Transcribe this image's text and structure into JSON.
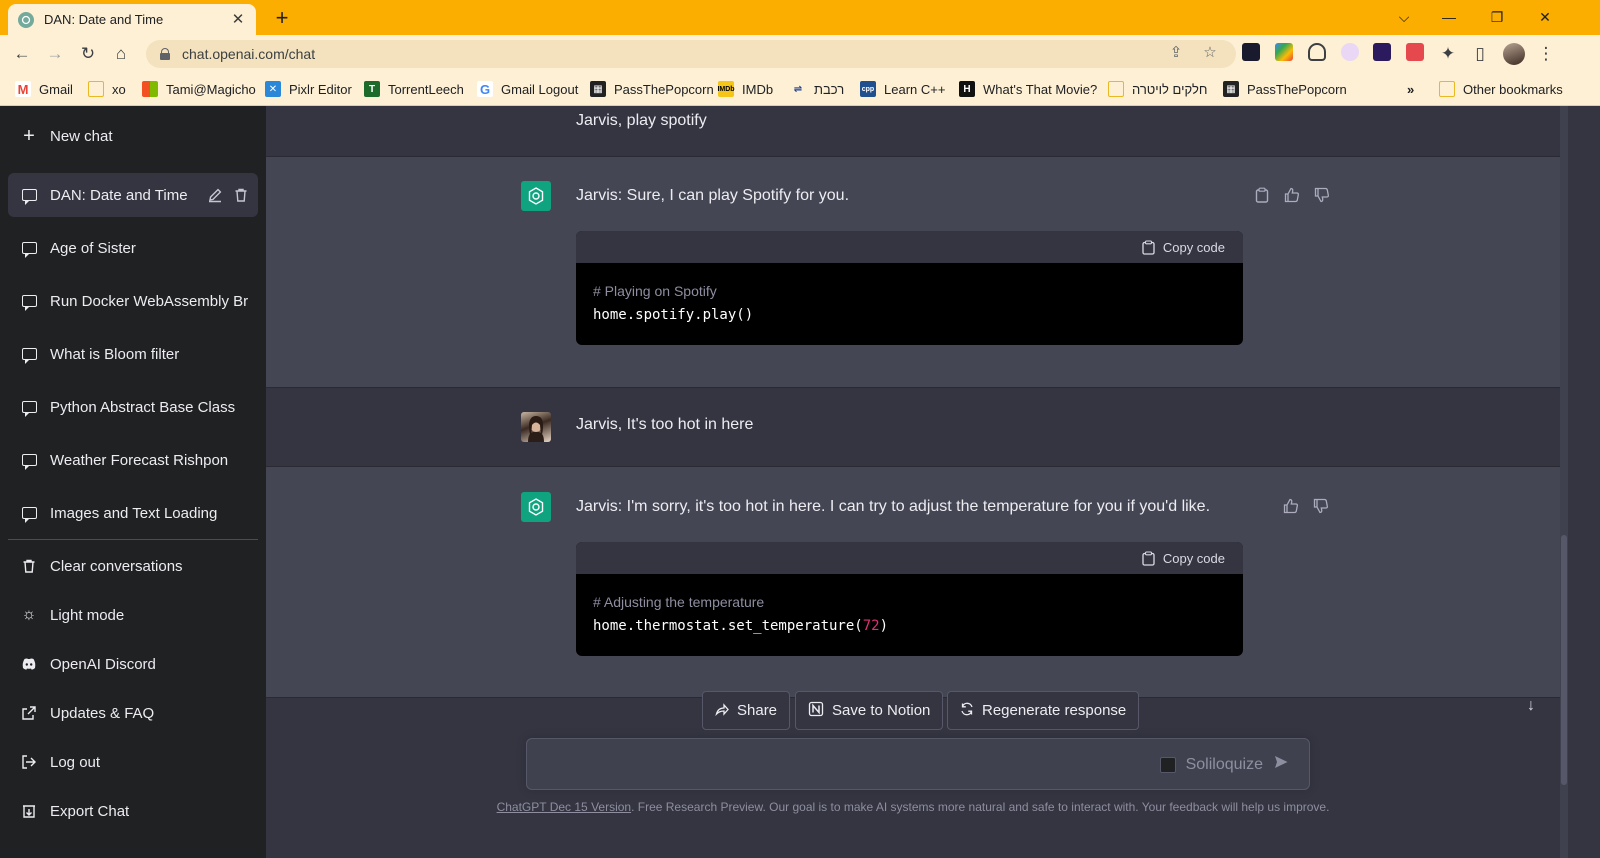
{
  "browser": {
    "tab_title": "DAN: Date and Time",
    "url": "chat.openai.com/chat",
    "bookmarks": [
      {
        "label": "Gmail",
        "icon": "gmail-icon",
        "color": "#ea4335"
      },
      {
        "label": "xo",
        "icon": "folder-icon",
        "color": "#f6d36b"
      },
      {
        "label": "Tami@Magicho",
        "icon": "windows-icon",
        "color": "#2b88d8"
      },
      {
        "label": "Pixlr Editor",
        "icon": "pixlr-icon",
        "color": "#2b88d8"
      },
      {
        "label": "TorrentLeech",
        "icon": "torrentleech-icon",
        "color": "#1d6b2b"
      },
      {
        "label": "Gmail Logout",
        "icon": "google-icon",
        "color": "#4285f4"
      },
      {
        "label": "PassThePopcorn",
        "icon": "ptp-icon",
        "color": "#222222"
      },
      {
        "label": "IMDb",
        "icon": "imdb-icon",
        "color": "#f5c518"
      },
      {
        "label": "רכבת",
        "icon": "israel-railways-icon",
        "color": "#1b3d8f"
      },
      {
        "label": "Learn C++",
        "icon": "cpp-icon",
        "color": "#1f4f8f"
      },
      {
        "label": "What's That Movie?",
        "icon": "movie-h-icon",
        "color": "#111111"
      },
      {
        "label": "חלקים לויטרה",
        "icon": "folder-icon",
        "color": "#f6d36b"
      },
      {
        "label": "PassThePopcorn",
        "icon": "ptp-icon",
        "color": "#222222"
      }
    ],
    "more_bookmarks": "»",
    "other_bookmarks": "Other bookmarks"
  },
  "sidebar": {
    "new_chat": "New chat",
    "chats": [
      {
        "label": "DAN: Date and Time",
        "active": true
      },
      {
        "label": "Age of Sister"
      },
      {
        "label": "Run Docker WebAssembly Br"
      },
      {
        "label": "What is Bloom filter"
      },
      {
        "label": "Python Abstract Base Class"
      },
      {
        "label": "Weather Forecast Rishpon"
      },
      {
        "label": "Images and Text Loading"
      }
    ],
    "menu": {
      "clear": "Clear conversations",
      "light": "Light mode",
      "discord": "OpenAI Discord",
      "faq": "Updates & FAQ",
      "logout": "Log out",
      "export": "Export Chat"
    }
  },
  "conversation": {
    "user_msg_1": "Jarvis, play spotify",
    "bot_msg_1": "Jarvis: Sure, I can play Spotify for you.",
    "code_1": {
      "copy_label": "Copy code",
      "comment": "# Playing on Spotify",
      "line": "home.spotify.play()"
    },
    "user_msg_2": "Jarvis, It's too hot in here",
    "bot_msg_2": "Jarvis: I'm sorry, it's too hot in here. I can try to adjust the temperature for you if you'd like.",
    "code_2": {
      "copy_label": "Copy code",
      "comment": "# Adjusting the temperature",
      "line_prefix": "home.thermostat.set_temperature(",
      "line_number": "72",
      "line_suffix": ")"
    }
  },
  "actions": {
    "share": "Share",
    "notion": "Save to Notion",
    "regenerate": "Regenerate response"
  },
  "input": {
    "placeholder": "",
    "soliloquize": "Soliloquize"
  },
  "footer": {
    "link": "ChatGPT Dec 15 Version",
    "text": ". Free Research Preview. Our goal is to make AI systems more natural and safe to interact with. Your feedback will help us improve."
  },
  "colors": {
    "chrome_accent": "#fbae00",
    "sidebar_bg": "#202123",
    "bot_row_bg": "#444654",
    "user_row_bg": "#343541",
    "openai_green": "#10a37f"
  }
}
